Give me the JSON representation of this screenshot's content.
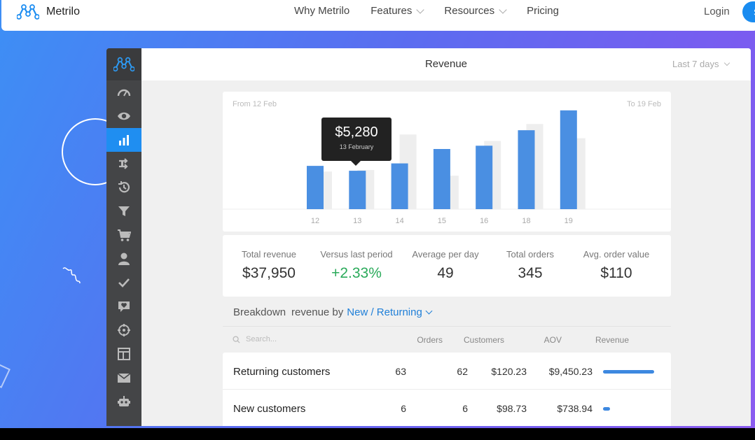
{
  "nav": {
    "brand": "Metrilo",
    "items": [
      {
        "label": "Why Metrilo",
        "dropdown": false
      },
      {
        "label": "Features",
        "dropdown": true
      },
      {
        "label": "Resources",
        "dropdown": true
      },
      {
        "label": "Pricing",
        "dropdown": false
      }
    ],
    "login": "Login",
    "signup": "S"
  },
  "colors": {
    "accent": "#1f8ef1",
    "bar_current": "#4a8fe2",
    "bar_previous": "#eeeeee",
    "positive": "#2aaa5a"
  },
  "sidebar": {
    "items": [
      {
        "icon": "gauge-icon",
        "active": false
      },
      {
        "icon": "eye-icon",
        "active": false
      },
      {
        "icon": "bar-chart-icon",
        "active": true
      },
      {
        "icon": "arrows-icon",
        "active": false
      },
      {
        "icon": "history-icon",
        "active": false
      },
      {
        "icon": "funnel-icon",
        "active": false
      },
      {
        "icon": "cart-icon",
        "active": false
      },
      {
        "icon": "user-icon",
        "active": false
      },
      {
        "icon": "check-icon",
        "active": false
      },
      {
        "icon": "heart-chat-icon",
        "active": false
      },
      {
        "icon": "target-icon",
        "active": false
      },
      {
        "icon": "layout-icon",
        "active": false
      },
      {
        "icon": "mail-icon",
        "active": false
      },
      {
        "icon": "robot-icon",
        "active": false
      }
    ]
  },
  "header": {
    "title": "Revenue",
    "range": "Last 7 days"
  },
  "chart_data": {
    "type": "bar",
    "from_label": "From 12 Feb",
    "to_label": "To 19 Feb",
    "categories": [
      "12",
      "13",
      "14",
      "15",
      "16",
      "18",
      "19"
    ],
    "series": [
      {
        "values": [
          5950,
          5280,
          6290,
          8270,
          8720,
          10850,
          13580
        ]
      },
      {
        "values": [
          5170,
          5380,
          10260,
          4600,
          9370,
          11710,
          9750
        ]
      }
    ],
    "ylim": [
      0,
      15000
    ],
    "tooltip": {
      "value": "$5,280",
      "date": "13 February"
    }
  },
  "stats": [
    {
      "label": "Total revenue",
      "value": "$37,950"
    },
    {
      "label": "Versus last period",
      "value": "+2.33%"
    },
    {
      "label": "Average per day",
      "value": "49"
    },
    {
      "label": "Total orders",
      "value": "345"
    },
    {
      "label": "Avg. order value",
      "value": "$110"
    }
  ],
  "breakdown": {
    "label": "Breakdown",
    "by": "revenue by",
    "selected": "New / Returning"
  },
  "table": {
    "search_placeholder": "Search...",
    "columns": [
      "Orders",
      "Customers",
      "AOV",
      "Revenue"
    ],
    "rows": [
      {
        "name": "Returning customers",
        "orders": "63",
        "customers": "62",
        "aov": "$120.23",
        "revenue": "$9,450.23",
        "share": 0.93
      },
      {
        "name": "New customers",
        "orders": "6",
        "customers": "6",
        "aov": "$98.73",
        "revenue": "$738.94",
        "share": 0.07
      }
    ]
  }
}
